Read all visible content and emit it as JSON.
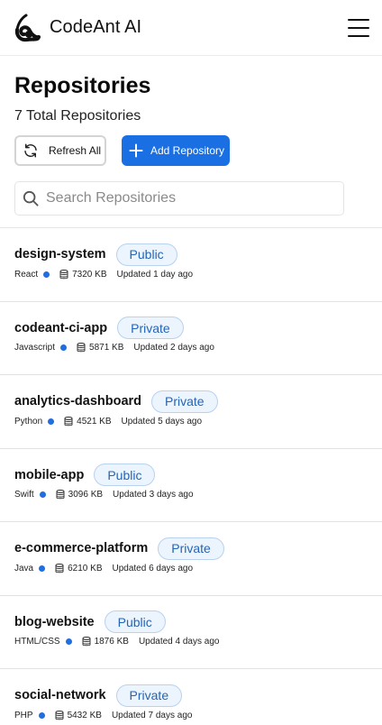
{
  "app": {
    "name": "CodeAnt AI"
  },
  "page": {
    "title": "Repositories",
    "total_label": "7 Total Repositories"
  },
  "actions": {
    "refresh_label": "Refresh All",
    "add_label": "Add Repository"
  },
  "search": {
    "placeholder": "Search Repositories",
    "value": ""
  },
  "colors": {
    "accent": "#1a6fe3",
    "badge_bg": "#ecf4fd",
    "badge_text": "#2565b5",
    "language_dot": "#1f6fe0"
  },
  "icons": {
    "logo": "codeant-logo-icon",
    "menu": "hamburger-menu-icon",
    "refresh": "refresh-icon",
    "add": "plus-icon",
    "search": "search-icon",
    "size": "database-icon"
  },
  "repositories": [
    {
      "name": "design-system",
      "visibility": "Public",
      "language": "React",
      "size": "7320 KB",
      "updated": "Updated 1 day ago"
    },
    {
      "name": "codeant-ci-app",
      "visibility": "Private",
      "language": "Javascript",
      "size": "5871 KB",
      "updated": "Updated 2 days ago"
    },
    {
      "name": "analytics-dashboard",
      "visibility": "Private",
      "language": "Python",
      "size": "4521 KB",
      "updated": "Updated 5 days ago"
    },
    {
      "name": "mobile-app",
      "visibility": "Public",
      "language": "Swift",
      "size": "3096 KB",
      "updated": "Updated 3 days ago"
    },
    {
      "name": "e-commerce-platform",
      "visibility": "Private",
      "language": "Java",
      "size": "6210 KB",
      "updated": "Updated 6 days ago"
    },
    {
      "name": "blog-website",
      "visibility": "Public",
      "language": "HTML/CSS",
      "size": "1876 KB",
      "updated": "Updated 4 days ago"
    },
    {
      "name": "social-network",
      "visibility": "Private",
      "language": "PHP",
      "size": "5432 KB",
      "updated": "Updated 7 days ago"
    }
  ]
}
